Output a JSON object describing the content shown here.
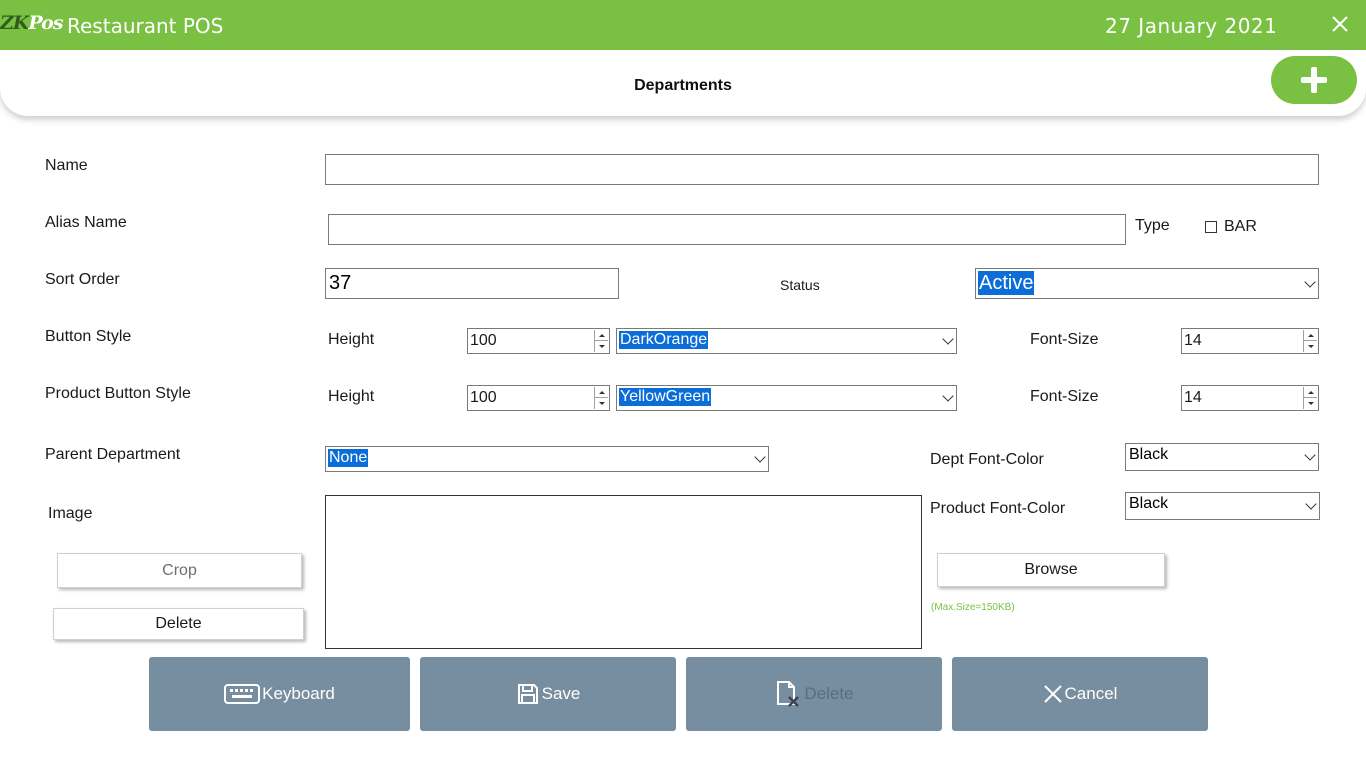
{
  "app": {
    "logo_zk": "ZK",
    "logo_pos": "Pos",
    "title": "Restaurant POS",
    "date": "27 January 2021"
  },
  "page": {
    "title": "Departments"
  },
  "form": {
    "name": {
      "label": "Name",
      "value": ""
    },
    "alias": {
      "label": "Alias Name",
      "value": ""
    },
    "type": {
      "label": "Type",
      "option_label": "BAR",
      "checked": false
    },
    "sort_order": {
      "label": "Sort Order",
      "value": "37"
    },
    "status": {
      "label": "Status",
      "value": "Active"
    },
    "button_style": {
      "label": "Button Style",
      "height_label": "Height",
      "height": "100",
      "color": "DarkOrange",
      "font_size_label": "Font-Size",
      "font_size": "14"
    },
    "product_button_style": {
      "label": "Product Button Style",
      "height_label": "Height",
      "height": "100",
      "color": "YellowGreen",
      "font_size_label": "Font-Size",
      "font_size": "14"
    },
    "parent_department": {
      "label": "Parent Department",
      "value": "None"
    },
    "dept_font_color": {
      "label": "Dept Font-Color",
      "value": "Black"
    },
    "product_font_color": {
      "label": "Product Font-Color",
      "value": "Black"
    },
    "image": {
      "label": "Image",
      "crop_label": "Crop",
      "delete_label": "Delete",
      "browse_label": "Browse",
      "max_size_hint": "(Max.Size=150KB)"
    }
  },
  "actions": {
    "keyboard": "Keyboard",
    "save": "Save",
    "delete": "Delete",
    "cancel": "Cancel"
  },
  "colors": {
    "brand_green": "#7ac143",
    "action_grey": "#778ea0",
    "selection_blue": "#0a6dd8"
  }
}
